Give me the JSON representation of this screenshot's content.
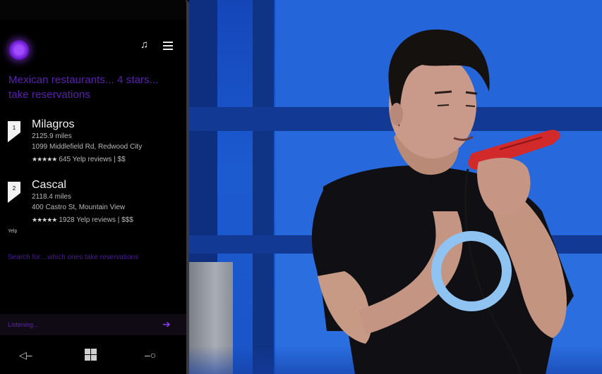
{
  "phone": {
    "query": "Mexican restaurants... 4 stars... take reservations",
    "icons": {
      "music": "music-note-icon",
      "menu": "hamburger-menu-icon",
      "cortana": "cortana-ring-icon"
    },
    "results": [
      {
        "rank": "1",
        "name": "Milagros",
        "distance": "2125.9 miles",
        "address": "1099 Middlefield Rd, Redwood City",
        "stars": "★★★★★",
        "reviews": "645 Yelp reviews | $$"
      },
      {
        "rank": "2",
        "name": "Cascal",
        "distance": "2118.4 miles",
        "address": "400 Castro St, Mountain View",
        "stars": "★★★★★",
        "reviews": "1928 Yelp reviews | $$$"
      }
    ],
    "source": "Yelp",
    "followup": "Search for…which ones take reservations",
    "listening": "Listening...",
    "navbar": {
      "back": "◁–",
      "search": "–○"
    }
  },
  "colors": {
    "cortana_purple": "#a14cff",
    "query_purple": "#5b1fb0",
    "stage_blue": "#1c5ad0"
  }
}
